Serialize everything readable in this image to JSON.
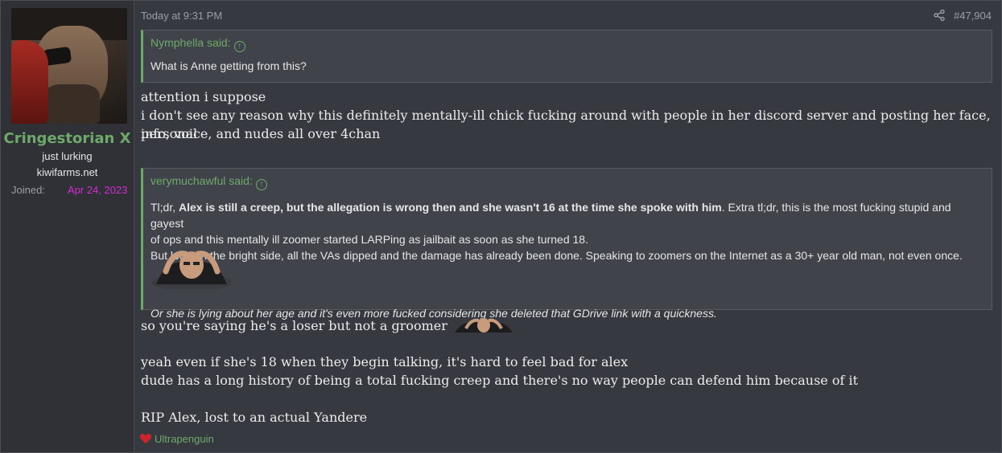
{
  "user": {
    "name": "Cringestorian X",
    "title": "just lurking",
    "site": "kiwifarms.net",
    "joined_label": "Joined:",
    "joined_date": "Apr 24, 2023"
  },
  "post": {
    "timestamp": "Today at 9:31 PM",
    "post_number": "#47,904"
  },
  "quote1": {
    "author": "Nymphella said:",
    "text": "What is Anne getting from this?"
  },
  "message1": {
    "line1": "attention i suppose",
    "line2": "i don't see any reason why this definitely mentally-ill chick fucking around with people in her discord server and posting her face, personal",
    "line3": "info, voice, and nudes all over 4chan"
  },
  "quote2": {
    "author": "verymuchawful said:",
    "line1_prefix": "Tl;dr, ",
    "line1_bold": "Alex is still a creep, but the allegation is wrong then and she wasn't 16 at the time she spoke with him",
    "line1_suffix": ". Extra tl;dr, this is the most fucking stupid and gayest",
    "line2": "of ops and this mentally ill zoomer started LARPing as jailbait as soon as she turned 18.",
    "line3": "But look on the bright side, all the VAs dipped and the damage has already been done. Speaking to zoomers on the Internet as a 30+ year old man, not even once.",
    "italic": "Or she is lying about her age and it's even more fucked considering she deleted that GDrive link with a quickness."
  },
  "message2": {
    "line1": "so you're saying he's a loser but not a groomer",
    "line2": "yeah even if she's 18 when they begin talking, it's hard to feel bad for alex",
    "line3": "dude has a long history of being a total fucking creep and there's no way people can defend him because of it",
    "line4": "RIP Alex, lost to an actual Yandere"
  },
  "reaction": {
    "icon": "heart-icon",
    "user": "Ultrapenguin"
  },
  "colors": {
    "accent": "#6ea96a",
    "joined_date": "#d42bd4",
    "background": "#36393f"
  }
}
